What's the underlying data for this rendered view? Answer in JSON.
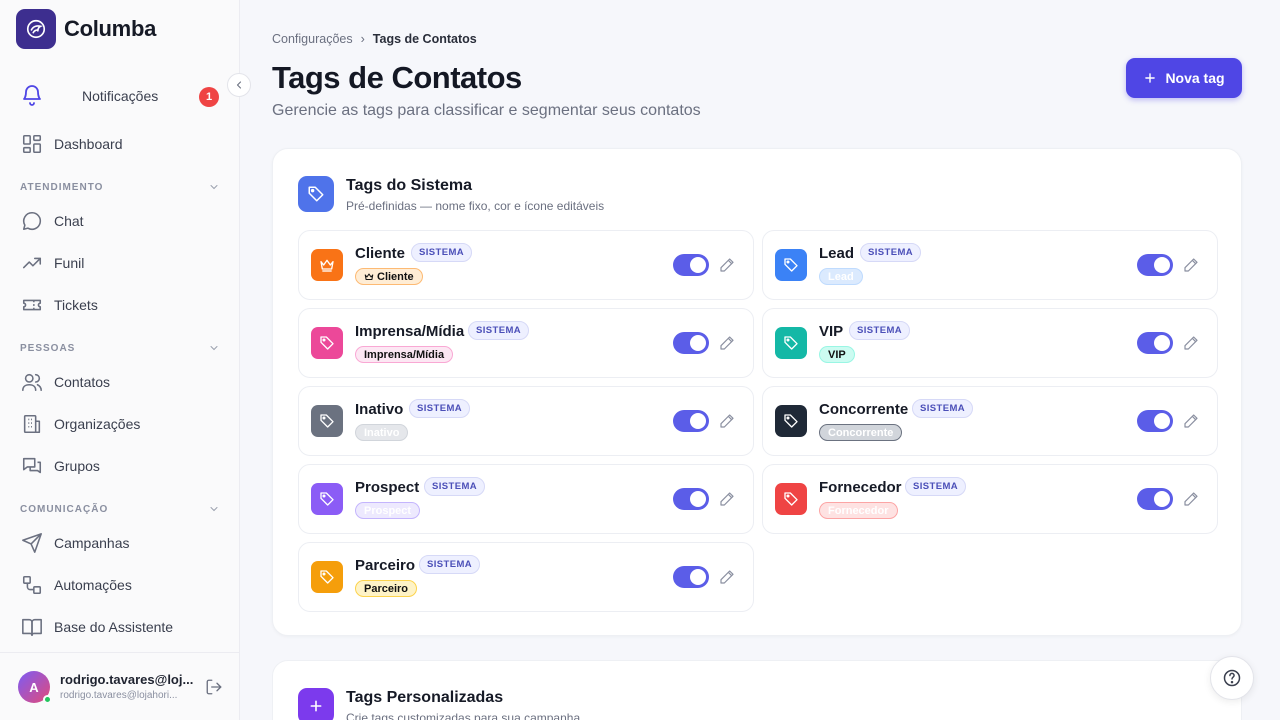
{
  "brand": {
    "name": "Columba"
  },
  "sidebar": {
    "notifications": {
      "label": "Notificações",
      "count": "1"
    },
    "dashboard": "Dashboard",
    "sections": {
      "atendimento": "ATENDIMENTO",
      "pessoas": "PESSOAS",
      "comunicacao": "COMUNICAÇÃO"
    },
    "items": {
      "chat": "Chat",
      "funil": "Funil",
      "tickets": "Tickets",
      "contatos": "Contatos",
      "organizacoes": "Organizações",
      "grupos": "Grupos",
      "campanhas": "Campanhas",
      "automacoes": "Automações",
      "base": "Base do Assistente"
    },
    "user": {
      "initial": "A",
      "name": "rodrigo.tavares@loj...",
      "email": "rodrigo.tavares@lojahori..."
    }
  },
  "breadcrumb": {
    "parent": "Configurações",
    "separator": "›",
    "current": "Tags de Contatos"
  },
  "page": {
    "title": "Tags de Contatos",
    "subtitle": "Gerencie as tags para classificar e segmentar seus contatos",
    "new_button": "Nova tag"
  },
  "system_tags": {
    "title": "Tags do Sistema",
    "subtitle": "Pré-definidas — nome fixo, cor e ícone editáveis",
    "badge": "SISTEMA",
    "colors": {
      "cliente": "#f97316",
      "lead": "#3b82f6",
      "imprensa": "#ec4899",
      "vip": "#14b8a6",
      "inativo": "#6b7280",
      "concorrente": "#1f2937",
      "prospect": "#8b5cf6",
      "fornecedor": "#ef4444",
      "parceiro": "#f59e0b"
    },
    "items": [
      {
        "name": "Cliente",
        "pill": "Cliente",
        "icon": "crown-icon"
      },
      {
        "name": "Lead",
        "pill": "Lead",
        "icon": "tag-icon"
      },
      {
        "name": "Imprensa/Mídia",
        "pill": "Imprensa/Mídia",
        "icon": "tag-icon"
      },
      {
        "name": "VIP",
        "pill": "VIP",
        "icon": "tag-icon"
      },
      {
        "name": "Inativo",
        "pill": "Inativo",
        "icon": "tag-icon"
      },
      {
        "name": "Concorrente",
        "pill": "Concorrente",
        "icon": "tag-icon"
      },
      {
        "name": "Prospect",
        "pill": "Prospect",
        "icon": "tag-icon"
      },
      {
        "name": "Fornecedor",
        "pill": "Fornecedor",
        "icon": "tag-icon"
      },
      {
        "name": "Parceiro",
        "pill": "Parceiro",
        "icon": "tag-icon"
      }
    ]
  },
  "custom_tags": {
    "title": "Tags Personalizadas",
    "subtitle": "Crie tags customizadas para sua campanha"
  }
}
